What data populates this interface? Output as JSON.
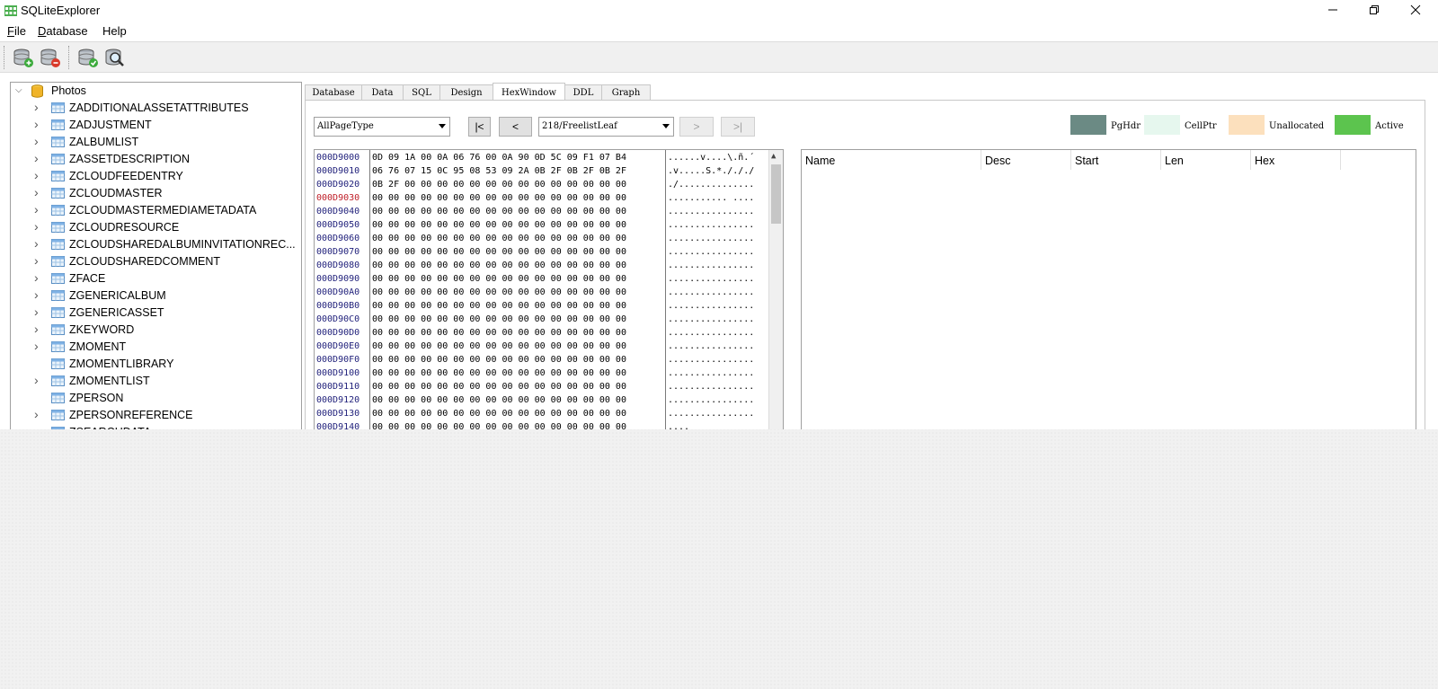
{
  "window": {
    "title": "SQLiteExplorer",
    "controls": {
      "minimize": "—",
      "restore": "❐",
      "close": "✕"
    }
  },
  "menu": {
    "items": [
      {
        "label": "File",
        "accel": "F",
        "rest": "ile"
      },
      {
        "label": "Database",
        "accel": "D",
        "rest": "atabase"
      },
      {
        "label": "Help",
        "accel": "",
        "rest": "Help"
      }
    ]
  },
  "toolbar": {
    "buttons": [
      "open-database-icon",
      "close-database-icon",
      "refresh-database-icon",
      "search-database-icon"
    ]
  },
  "tree": {
    "root": "Photos",
    "items": [
      {
        "label": "ZADDITIONALASSETATTRIBUTES",
        "expandable": true
      },
      {
        "label": "ZADJUSTMENT",
        "expandable": true
      },
      {
        "label": "ZALBUMLIST",
        "expandable": true
      },
      {
        "label": "ZASSETDESCRIPTION",
        "expandable": true
      },
      {
        "label": "ZCLOUDFEEDENTRY",
        "expandable": true
      },
      {
        "label": "ZCLOUDMASTER",
        "expandable": true
      },
      {
        "label": "ZCLOUDMASTERMEDIAMETADATA",
        "expandable": true
      },
      {
        "label": "ZCLOUDRESOURCE",
        "expandable": true
      },
      {
        "label": "ZCLOUDSHAREDALBUMINVITATIONREC...",
        "expandable": true
      },
      {
        "label": "ZCLOUDSHAREDCOMMENT",
        "expandable": true
      },
      {
        "label": "ZFACE",
        "expandable": true
      },
      {
        "label": "ZGENERICALBUM",
        "expandable": true
      },
      {
        "label": "ZGENERICASSET",
        "expandable": true
      },
      {
        "label": "ZKEYWORD",
        "expandable": true
      },
      {
        "label": "ZMOMENT",
        "expandable": true
      },
      {
        "label": "ZMOMENTLIBRARY",
        "expandable": false
      },
      {
        "label": "ZMOMENTLIST",
        "expandable": true
      },
      {
        "label": "ZPERSON",
        "expandable": false
      },
      {
        "label": "ZPERSONREFERENCE",
        "expandable": true
      },
      {
        "label": "ZSEARCHDATA",
        "expandable": true
      }
    ]
  },
  "tabs": {
    "items": [
      "Database",
      "Data",
      "SQL",
      "Design",
      "HexWindow",
      "DDL",
      "Graph"
    ],
    "active": "HexWindow"
  },
  "hex_controls": {
    "page_type": "AllPageType",
    "page_select": "218/FreelistLeaf",
    "first": "|<",
    "prev": "<",
    "next": ">",
    "last": ">|"
  },
  "legend": [
    {
      "label": "PgHdr",
      "color": "#6b8a84"
    },
    {
      "label": "CellPtr",
      "color": "#e6f7ee"
    },
    {
      "label": "Unallocated",
      "color": "#fce0bd"
    },
    {
      "label": "Active",
      "color": "#5cc44e"
    }
  ],
  "hex": {
    "highlight_address": "000D9030",
    "rows": [
      {
        "addr": "000D9000",
        "bytes": "0D 09 1A 00 0A 06 76 00 0A 90 0D 5C 09 F1 07 B4",
        "ascii": "......v....\\.ñ.´"
      },
      {
        "addr": "000D9010",
        "bytes": "06 76 07 15 0C 95 08 53 09 2A 0B 2F 0B 2F 0B 2F",
        "ascii": ".v.....S.*./././"
      },
      {
        "addr": "000D9020",
        "bytes": "0B 2F 00 00 00 00 00 00 00 00 00 00 00 00 00 00",
        "ascii": "./.............."
      },
      {
        "addr": "000D9030",
        "bytes": "00 00 00 00 00 00 00 00 00 00 00 00 00 00 00 00",
        "ascii": "........... ...."
      },
      {
        "addr": "000D9040",
        "bytes": "00 00 00 00 00 00 00 00 00 00 00 00 00 00 00 00",
        "ascii": "................"
      },
      {
        "addr": "000D9050",
        "bytes": "00 00 00 00 00 00 00 00 00 00 00 00 00 00 00 00",
        "ascii": "................"
      },
      {
        "addr": "000D9060",
        "bytes": "00 00 00 00 00 00 00 00 00 00 00 00 00 00 00 00",
        "ascii": "................"
      },
      {
        "addr": "000D9070",
        "bytes": "00 00 00 00 00 00 00 00 00 00 00 00 00 00 00 00",
        "ascii": "................"
      },
      {
        "addr": "000D9080",
        "bytes": "00 00 00 00 00 00 00 00 00 00 00 00 00 00 00 00",
        "ascii": "................"
      },
      {
        "addr": "000D9090",
        "bytes": "00 00 00 00 00 00 00 00 00 00 00 00 00 00 00 00",
        "ascii": "................"
      },
      {
        "addr": "000D90A0",
        "bytes": "00 00 00 00 00 00 00 00 00 00 00 00 00 00 00 00",
        "ascii": "................"
      },
      {
        "addr": "000D90B0",
        "bytes": "00 00 00 00 00 00 00 00 00 00 00 00 00 00 00 00",
        "ascii": "................"
      },
      {
        "addr": "000D90C0",
        "bytes": "00 00 00 00 00 00 00 00 00 00 00 00 00 00 00 00",
        "ascii": "................"
      },
      {
        "addr": "000D90D0",
        "bytes": "00 00 00 00 00 00 00 00 00 00 00 00 00 00 00 00",
        "ascii": "................"
      },
      {
        "addr": "000D90E0",
        "bytes": "00 00 00 00 00 00 00 00 00 00 00 00 00 00 00 00",
        "ascii": "................"
      },
      {
        "addr": "000D90F0",
        "bytes": "00 00 00 00 00 00 00 00 00 00 00 00 00 00 00 00",
        "ascii": "................"
      },
      {
        "addr": "000D9100",
        "bytes": "00 00 00 00 00 00 00 00 00 00 00 00 00 00 00 00",
        "ascii": "................"
      },
      {
        "addr": "000D9110",
        "bytes": "00 00 00 00 00 00 00 00 00 00 00 00 00 00 00 00",
        "ascii": "................"
      },
      {
        "addr": "000D9120",
        "bytes": "00 00 00 00 00 00 00 00 00 00 00 00 00 00 00 00",
        "ascii": "................"
      },
      {
        "addr": "000D9130",
        "bytes": "00 00 00 00 00 00 00 00 00 00 00 00 00 00 00 00",
        "ascii": "................"
      },
      {
        "addr": "000D9140",
        "bytes": "00 00 00 00 00 00 00 00 00 00 00 00 00 00 00 00",
        "ascii": "...."
      }
    ]
  },
  "struct_table": {
    "columns": [
      "Name",
      "Desc",
      "Start",
      "Len",
      "Hex"
    ]
  }
}
